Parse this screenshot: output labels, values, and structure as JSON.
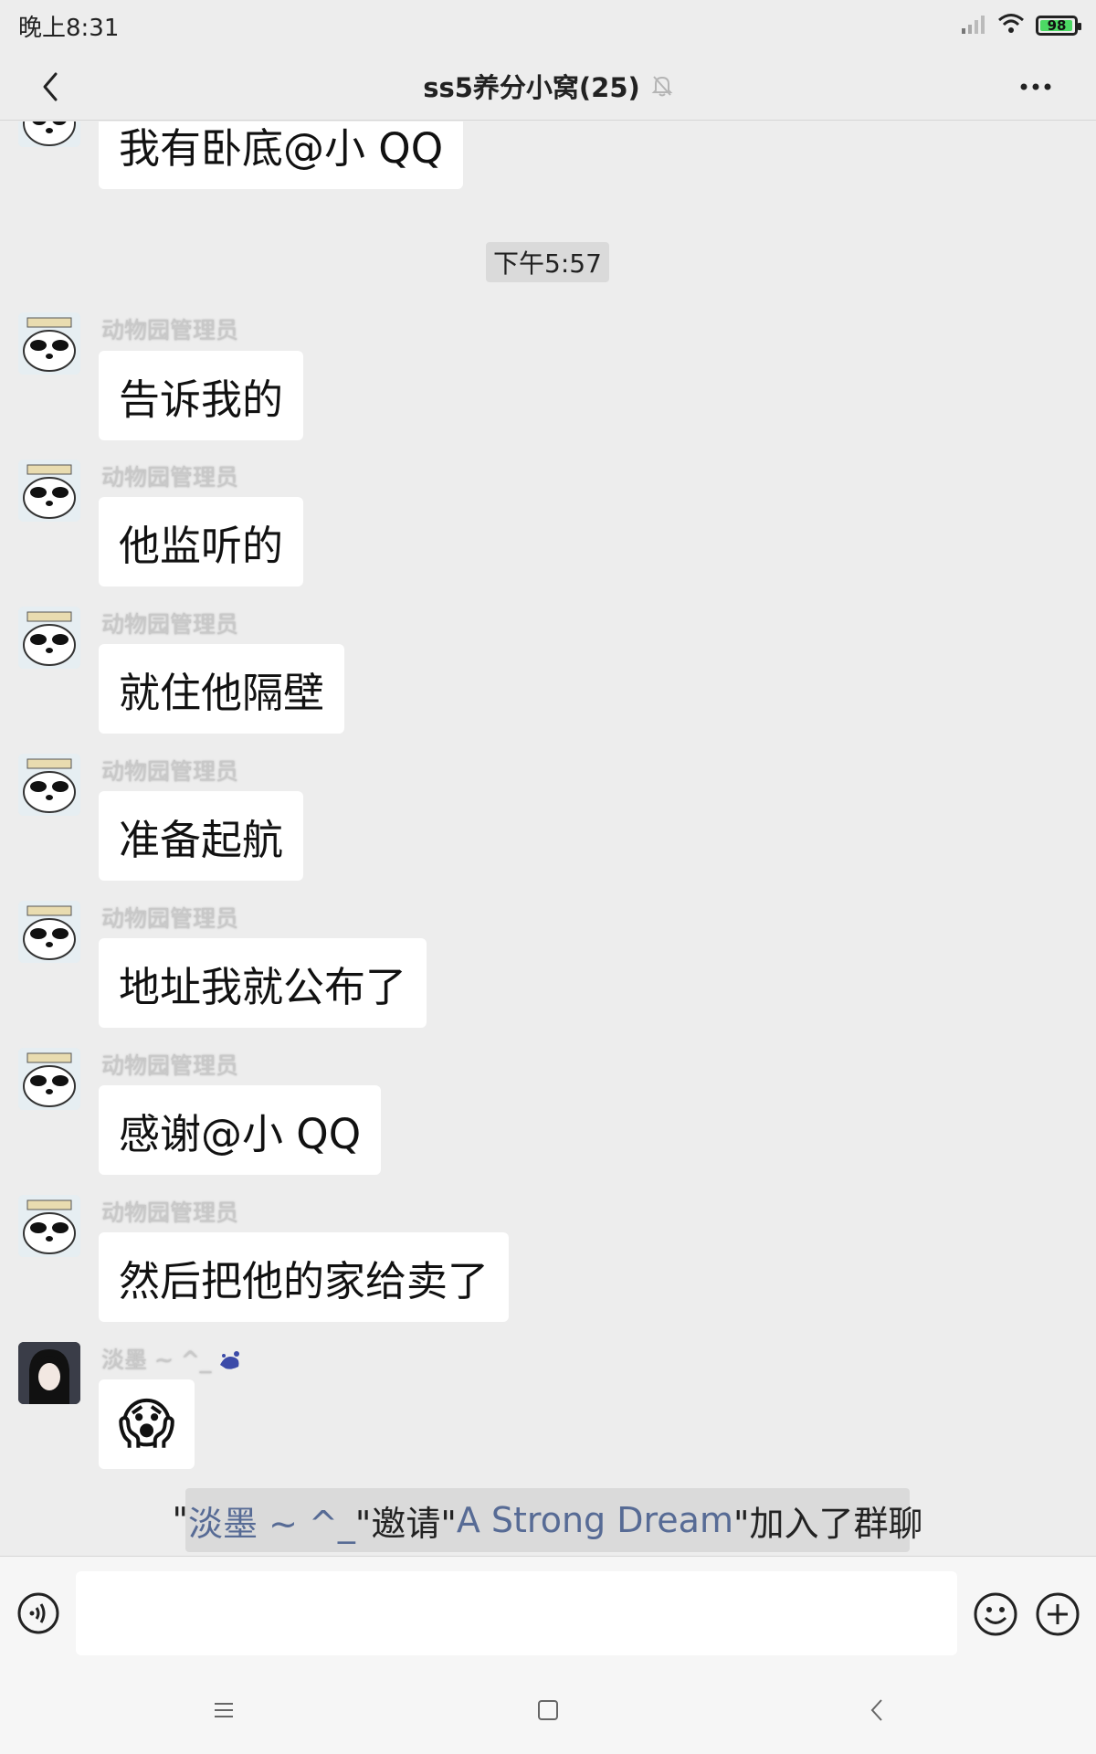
{
  "status_bar": {
    "time": "晚上8:31",
    "battery": "98",
    "battery_level": 0.98
  },
  "header": {
    "title": "ss5养分小窝(25)",
    "back_icon": "chevron-left-icon",
    "mute_icon": "bell-off-icon",
    "more_icon": "more-dots-icon"
  },
  "messages": [
    {
      "type": "text",
      "text": "我有卧底@小 QQ"
    },
    {
      "type": "time",
      "text": "下午5:57"
    },
    {
      "type": "text",
      "sender": "动物园管理员",
      "text": "告诉我的"
    },
    {
      "type": "text",
      "sender": "动物园管理员",
      "text": "他监听的"
    },
    {
      "type": "text",
      "sender": "动物园管理员",
      "text": "就住他隔壁"
    },
    {
      "type": "text",
      "sender": "动物园管理员",
      "text": "准备起航"
    },
    {
      "type": "text",
      "sender": "动物园管理员",
      "text": "地址我就公布了"
    },
    {
      "type": "text",
      "sender": "动物园管理员",
      "text": "感谢@小 QQ"
    },
    {
      "type": "text",
      "sender": "动物园管理员",
      "text": "然后把他的家给卖了"
    },
    {
      "type": "emoji",
      "sender": "淡墨 ~ ^_",
      "text": "😱"
    }
  ],
  "system_message": {
    "q1": "\"",
    "inviter": "淡墨 ~ ^_",
    "mid": "\"邀请\"",
    "invitee": "A Strong Dream",
    "tail": "\"加入了群聊"
  },
  "input_bar": {
    "placeholder": "",
    "voice_icon": "voice-icon",
    "emoji_icon": "emoji-icon",
    "plus_icon": "plus-circle-icon"
  },
  "nav_bar": {
    "menu_icon": "menu-icon",
    "home_icon": "home-square-icon",
    "back_icon": "nav-back-icon"
  },
  "colors": {
    "background": "#ededed",
    "bubble": "#ffffff",
    "link": "#576b95",
    "battery": "#4cd964"
  }
}
